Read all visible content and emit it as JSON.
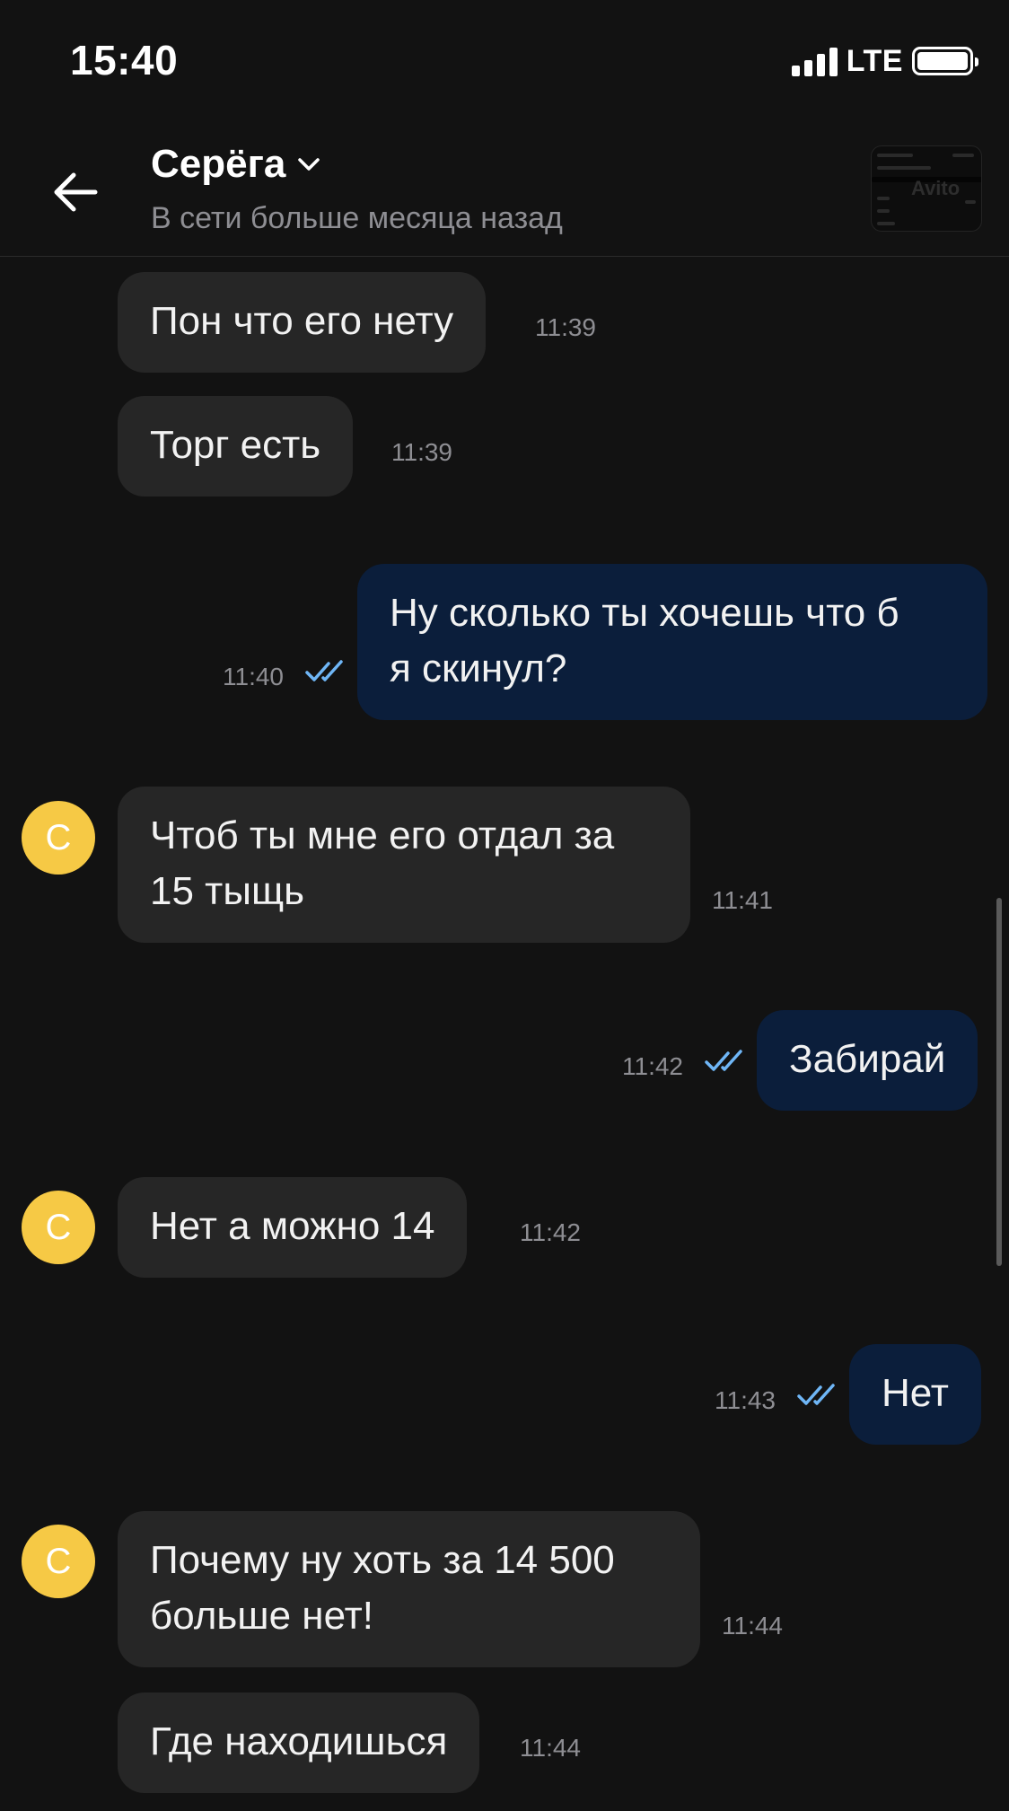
{
  "status_bar": {
    "time": "15:40",
    "carrier": "LTE",
    "battery_level": 1.0
  },
  "header": {
    "contact_name": "Серёга",
    "contact_status": "В сети больше месяца назад",
    "ad_thumbnail_watermark": "Avito"
  },
  "avatar_letter": "С",
  "messages": [
    {
      "direction": "in",
      "text": "Пон что его нету",
      "time": "11:39",
      "avatar": false
    },
    {
      "direction": "in",
      "text": "Торг есть",
      "time": "11:39",
      "avatar": false
    },
    {
      "direction": "out",
      "line1": "Ну сколько ты хочешь что б",
      "line2": "я скинул?",
      "time": "11:40",
      "read": true
    },
    {
      "direction": "in",
      "line1": "Чтоб ты мне его отдал за",
      "line2": "15 тыщь",
      "time": "11:41",
      "avatar": true
    },
    {
      "direction": "out",
      "text": "Забирай",
      "time": "11:42",
      "read": true
    },
    {
      "direction": "in",
      "text": "Нет а можно 14",
      "time": "11:42",
      "avatar": true
    },
    {
      "direction": "out",
      "text": "Нет",
      "time": "11:43",
      "read": true
    },
    {
      "direction": "in",
      "line1": "Почему ну хоть за 14 500",
      "line2": "больше нет!",
      "time": "11:44",
      "avatar": true
    },
    {
      "direction": "in",
      "text": "Где находишься",
      "time": "11:44",
      "avatar": false
    }
  ],
  "colors": {
    "background": "#121212",
    "incoming_bubble": "#262626",
    "outgoing_bubble": "#0b1e3b",
    "read_check": "#6fb6f6",
    "avatar": "#f6c945"
  }
}
